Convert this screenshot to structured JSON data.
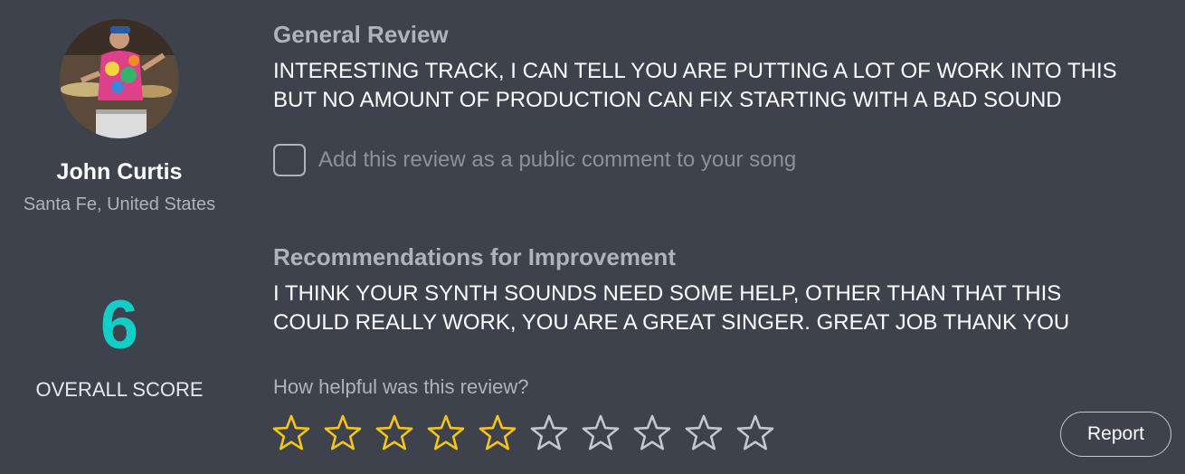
{
  "reviewer": {
    "name": "John Curtis",
    "location": "Santa Fe, United States"
  },
  "score": {
    "value": "6",
    "label": "OVERALL SCORE",
    "color": "#13cec6"
  },
  "general_review": {
    "heading": "General Review",
    "text": "INTERESTING TRACK, I CAN TELL YOU ARE PUTTING A LOT OF WORK INTO THIS\nBUT NO AMOUNT OF PRODUCTION CAN FIX STARTING WITH A BAD SOUND"
  },
  "public_comment": {
    "checked": false,
    "label": "Add this review as a public comment to your song"
  },
  "recommendations": {
    "heading": "Recommendations for Improvement",
    "text": "I THINK YOUR SYNTH SOUNDS NEED SOME HELP, OTHER THAN THAT THIS\nCOULD REALLY WORK, YOU ARE A GREAT SINGER. GREAT JOB THANK YOU"
  },
  "helpfulness": {
    "question": "How helpful was this review?",
    "rating": 5,
    "max": 10,
    "filled_color": "#f5c518",
    "empty_color": "#c3c7ce",
    "star_icon": "star-icon"
  },
  "report": {
    "label": "Report"
  },
  "colors": {
    "background": "#3d424d"
  }
}
